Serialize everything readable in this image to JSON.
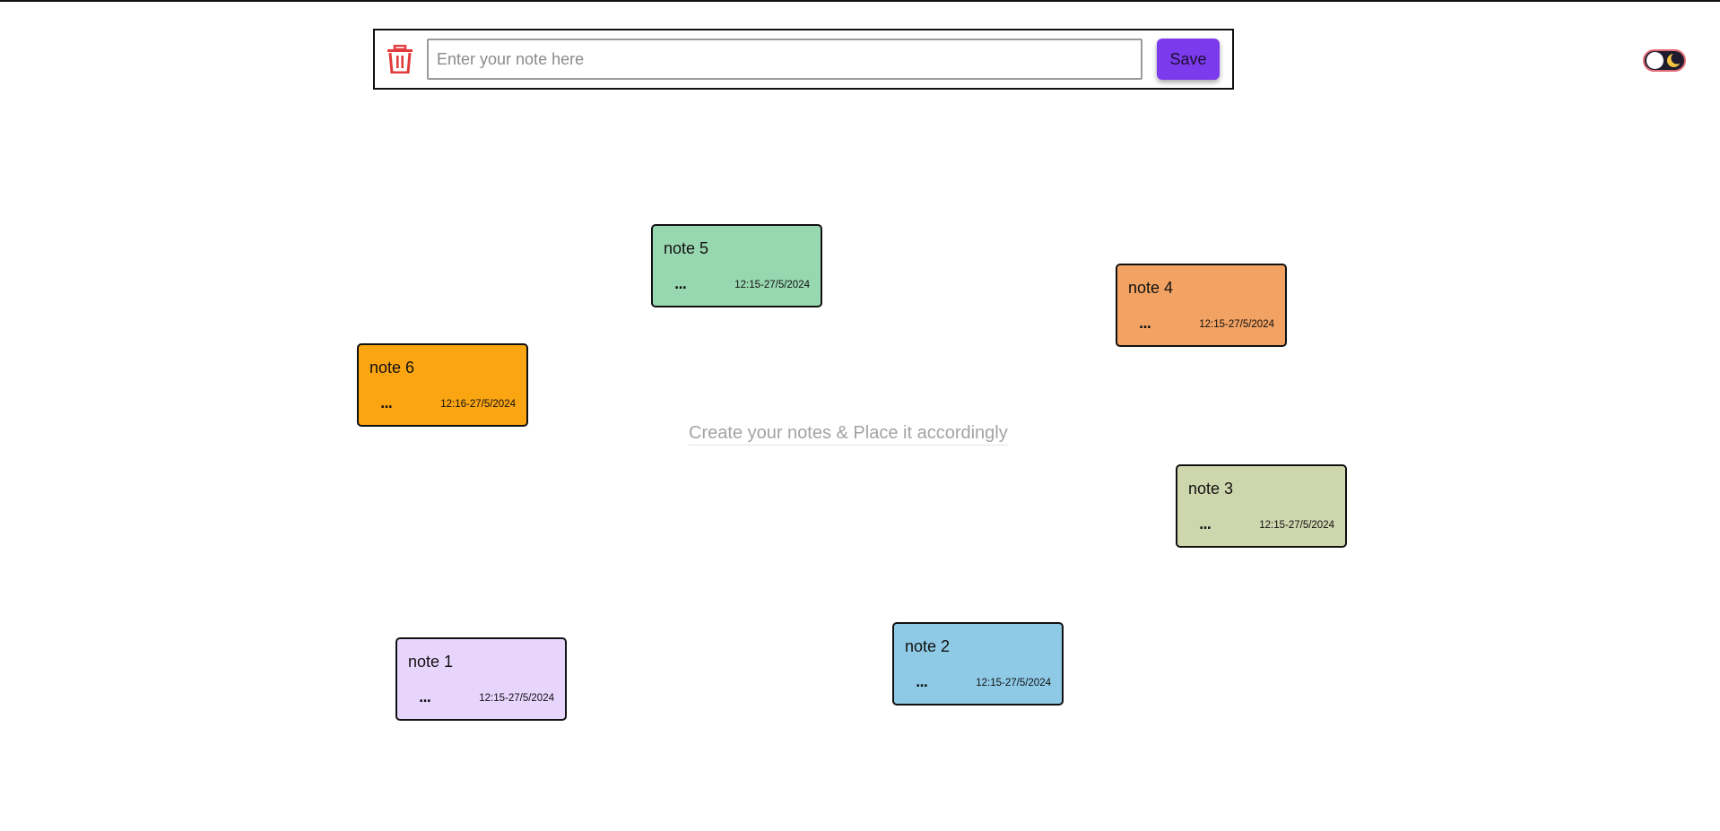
{
  "toolbar": {
    "delete_icon": "trash-icon",
    "input_placeholder": "Enter your note here",
    "input_value": "",
    "save_label": "Save"
  },
  "theme_toggle": {
    "icon": "moon-icon",
    "state": "dark"
  },
  "hint": "Create your notes & Place it accordingly",
  "notes": [
    {
      "id": "note-5",
      "title": "note 5",
      "timestamp": "12:15-27/5/2024",
      "color": "#98d8b0",
      "menu": "..."
    },
    {
      "id": "note-4",
      "title": "note 4",
      "timestamp": "12:15-27/5/2024",
      "color": "#f2a262",
      "menu": "..."
    },
    {
      "id": "note-6",
      "title": "note 6",
      "timestamp": "12:16-27/5/2024",
      "color": "#fba512",
      "menu": "..."
    },
    {
      "id": "note-3",
      "title": "note 3",
      "timestamp": "12:15-27/5/2024",
      "color": "#ced6ad",
      "menu": "..."
    },
    {
      "id": "note-2",
      "title": "note 2",
      "timestamp": "12:15-27/5/2024",
      "color": "#8ecae6",
      "menu": "..."
    },
    {
      "id": "note-1",
      "title": "note 1",
      "timestamp": "12:15-27/5/2024",
      "color": "#e8d5fe",
      "menu": "..."
    }
  ],
  "colors": {
    "accent": "#7c3aed",
    "delete": "#e23b3b"
  }
}
